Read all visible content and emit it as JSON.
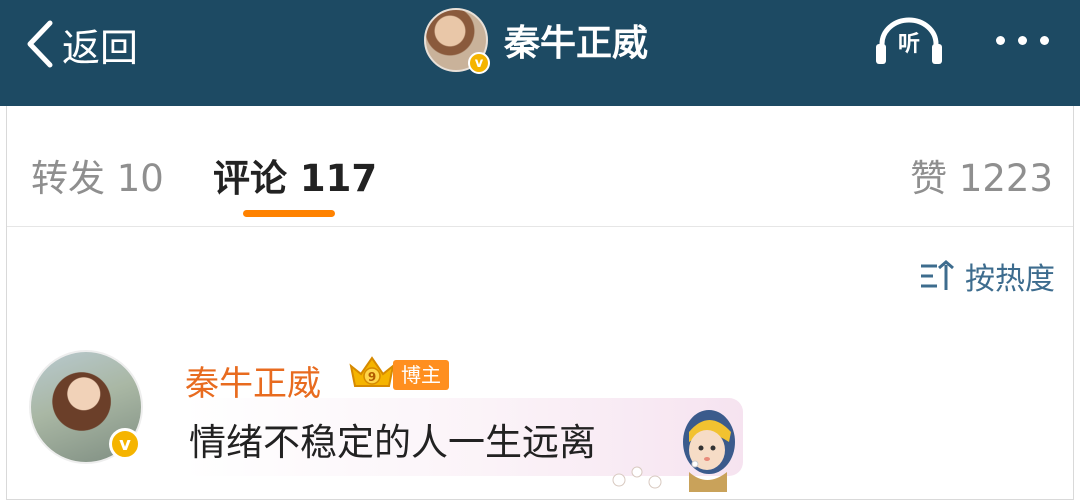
{
  "nav": {
    "back_label": "返回",
    "title": "秦牛正威",
    "verified_mark": "v",
    "listen_label": "听",
    "more_icon": "more-horizontal-icon",
    "background_color": "#1d4a63"
  },
  "tabs": {
    "forward": "转发 10",
    "comment": "评论 117",
    "like": "赞 1223",
    "active": "comment",
    "accent_color": "#ff8200"
  },
  "sort": {
    "label": "按热度",
    "icon": "sort-icon"
  },
  "comment": {
    "author": "秦牛正威",
    "author_color": "#e86b1f",
    "badge_level": "9",
    "badge_label": "博主",
    "verified_mark": "v",
    "text": "情绪不稳定的人一生远离"
  }
}
